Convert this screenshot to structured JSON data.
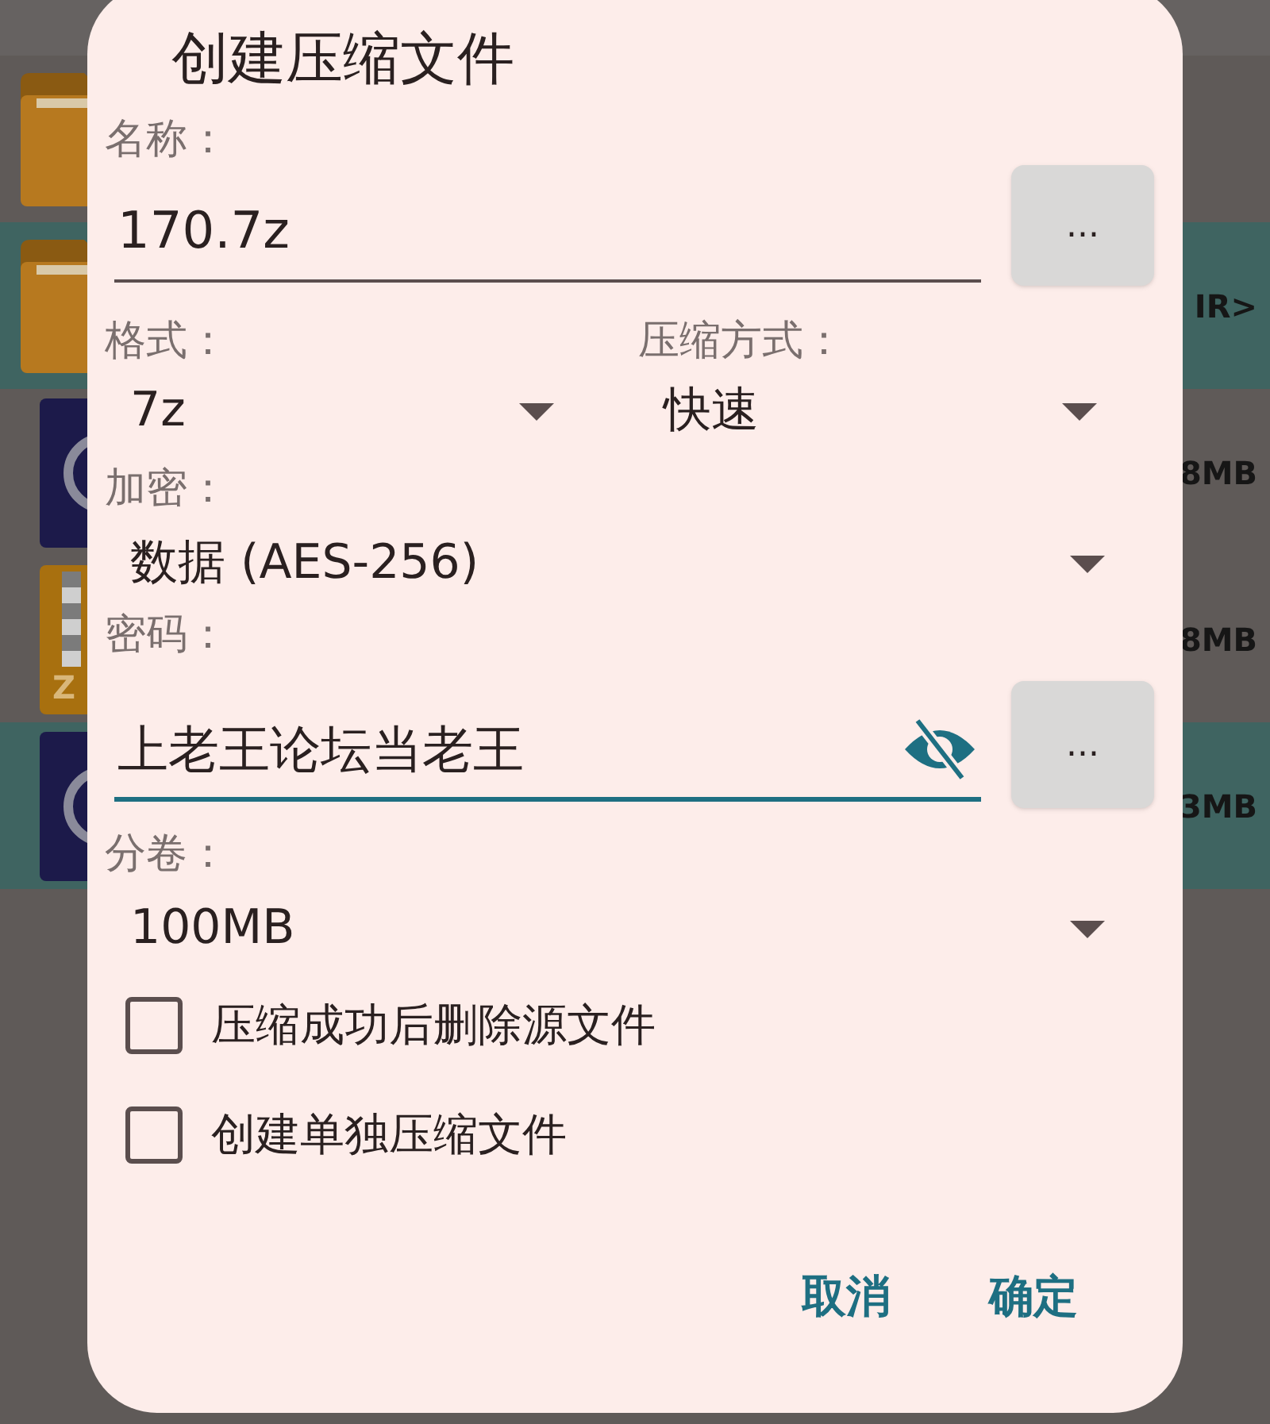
{
  "background_list": {
    "rows": [
      {
        "kind": "folder",
        "selected": false
      },
      {
        "kind": "folder",
        "selected": true,
        "size": "IR>"
      },
      {
        "kind": "file",
        "selected": false,
        "size": "8MB"
      },
      {
        "kind": "zip",
        "selected": false,
        "size": "8MB",
        "icon_letter": "Z"
      },
      {
        "kind": "file",
        "selected": true,
        "size": "3MB"
      }
    ]
  },
  "dialog": {
    "title": "创建压缩文件",
    "name": {
      "label": "名称：",
      "value": "170.7z",
      "browse": "..."
    },
    "format": {
      "label": "格式：",
      "value": "7z"
    },
    "method": {
      "label": "压缩方式：",
      "value": "快速"
    },
    "encryption": {
      "label": "加密：",
      "value": "数据 (AES-256)"
    },
    "password": {
      "label": "密码：",
      "value": "上老王论坛当老王",
      "focused": true,
      "browse": "..."
    },
    "volume": {
      "label": "分卷：",
      "value": "100MB"
    },
    "options": [
      {
        "label": "压缩成功后删除源文件",
        "checked": false
      },
      {
        "label": "创建单独压缩文件",
        "checked": false
      }
    ],
    "buttons": [
      "取消",
      "确定"
    ]
  }
}
